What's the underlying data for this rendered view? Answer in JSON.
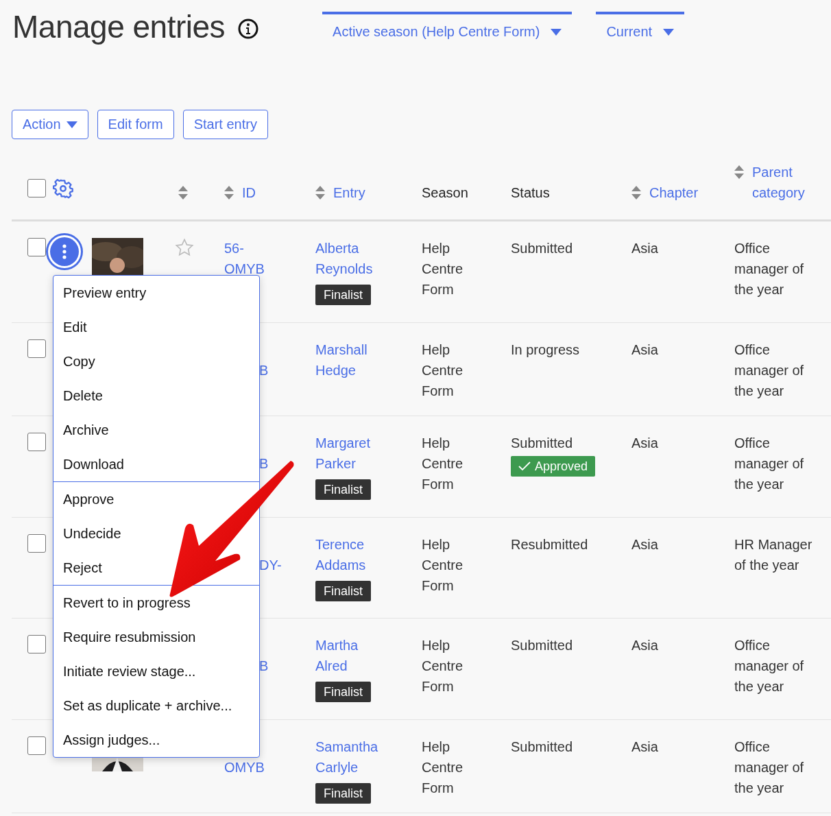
{
  "title": "Manage entries",
  "filters": [
    {
      "label": "Active season (Help Centre Form)"
    },
    {
      "label": "Current"
    }
  ],
  "buttons": [
    {
      "label": "Action",
      "kind": "dropdown"
    },
    {
      "label": "Edit form",
      "kind": "plain"
    },
    {
      "label": "Start entry",
      "kind": "plain"
    }
  ],
  "table": {
    "select_all": {
      "checked": false
    },
    "columns": [
      {
        "sortable": true
      },
      {
        "label": "ID",
        "sortable": true
      },
      {
        "label": "Entry",
        "sortable": true
      },
      {
        "label": "Season",
        "sortable": false
      },
      {
        "label": "Status",
        "sortable": false
      },
      {
        "label": "Chapter",
        "sortable": true
      },
      {
        "label": "Parent category",
        "sortable": true
      }
    ],
    "rows": [
      {
        "checked": false,
        "menu_open": true,
        "starred": false,
        "id": {
          "text": "56-OMYB",
          "kind": "whole"
        },
        "entry": "Alberta Reynolds",
        "badge": "Finalist",
        "season": "Help Centre Form",
        "status": "Submitted",
        "chapter": "Asia",
        "parent_category": "Office manager of the year"
      },
      {
        "checked": false,
        "id": {
          "text": "B",
          "kind": "tail"
        },
        "entry": "Marshall Hedge",
        "season": "Help Centre Form",
        "status": "In progress",
        "chapter": "Asia",
        "parent_category": "Office manager of the year"
      },
      {
        "checked": false,
        "id": {
          "text": "B",
          "kind": "tail"
        },
        "entry": "Margaret Parker",
        "badge": "Finalist",
        "season": "Help Centre Form",
        "status": "Submitted",
        "approval": "Approved",
        "chapter": "Asia",
        "parent_category": "Office manager of the year"
      },
      {
        "checked": false,
        "id": {
          "text": "DY-",
          "kind": "tail"
        },
        "entry": "Terence Addams",
        "badge": "Finalist",
        "season": "Help Centre Form",
        "status": "Resubmitted",
        "chapter": "Asia",
        "parent_category": "HR Manager of the year"
      },
      {
        "checked": false,
        "id": {
          "text": "B",
          "kind": "tail"
        },
        "entry": "Martha Alred",
        "badge": "Finalist",
        "season": "Help Centre Form",
        "status": "Submitted",
        "chapter": "Asia",
        "parent_category": "Office manager of the year"
      },
      {
        "checked": false,
        "id": {
          "text": "OMYB",
          "kind": "second_line"
        },
        "entry": "Samantha Carlyle",
        "badge": "Finalist",
        "season": "Help Centre Form",
        "status": "Submitted",
        "chapter": "Asia",
        "parent_category": "Office manager of the year"
      }
    ]
  },
  "menu": {
    "groups": [
      [
        "Preview entry",
        "Edit",
        "Copy",
        "Delete",
        "Archive",
        "Download"
      ],
      [
        "Approve",
        "Undecide",
        "Reject"
      ],
      [
        "Revert to in progress",
        "Require resubmission",
        "Initiate review stage...",
        "Set as duplicate + archive...",
        "Assign judges..."
      ]
    ]
  },
  "annotation": {
    "kind": "arrow"
  }
}
